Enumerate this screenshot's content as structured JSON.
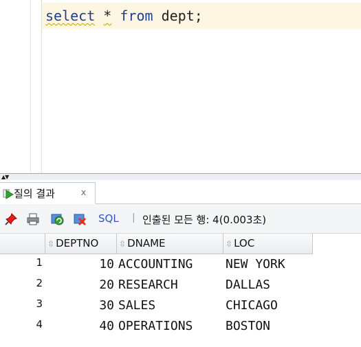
{
  "editor": {
    "code_tokens": [
      "select",
      " ",
      "*",
      " ",
      "from",
      " dept;"
    ]
  },
  "results_tab": {
    "label": "질의 결과",
    "close": "x"
  },
  "toolbar": {
    "sql_label": "SQL",
    "separator": "|",
    "status": "인출된 모든 행: 4(0.003초)"
  },
  "grid": {
    "columns": [
      "DEPTNO",
      "DNAME",
      "LOC"
    ],
    "rows": [
      {
        "num": "1",
        "deptno": "10",
        "dname": "ACCOUNTING",
        "loc": "NEW YORK"
      },
      {
        "num": "2",
        "deptno": "20",
        "dname": "RESEARCH",
        "loc": "DALLAS"
      },
      {
        "num": "3",
        "deptno": "30",
        "dname": "SALES",
        "loc": "CHICAGO"
      },
      {
        "num": "4",
        "deptno": "40",
        "dname": "OPERATIONS",
        "loc": "BOSTON"
      }
    ]
  },
  "icons": {
    "splitter": "splitter-arrows-icon",
    "tab": "run-query-icon",
    "pin": "pin-icon",
    "print": "print-icon",
    "refresh": "refresh-icon",
    "export": "delete-icon"
  },
  "colors": {
    "keyword": "#1f3e8c",
    "sql_link": "#3355c4",
    "current_line": "#fdf6e3"
  }
}
